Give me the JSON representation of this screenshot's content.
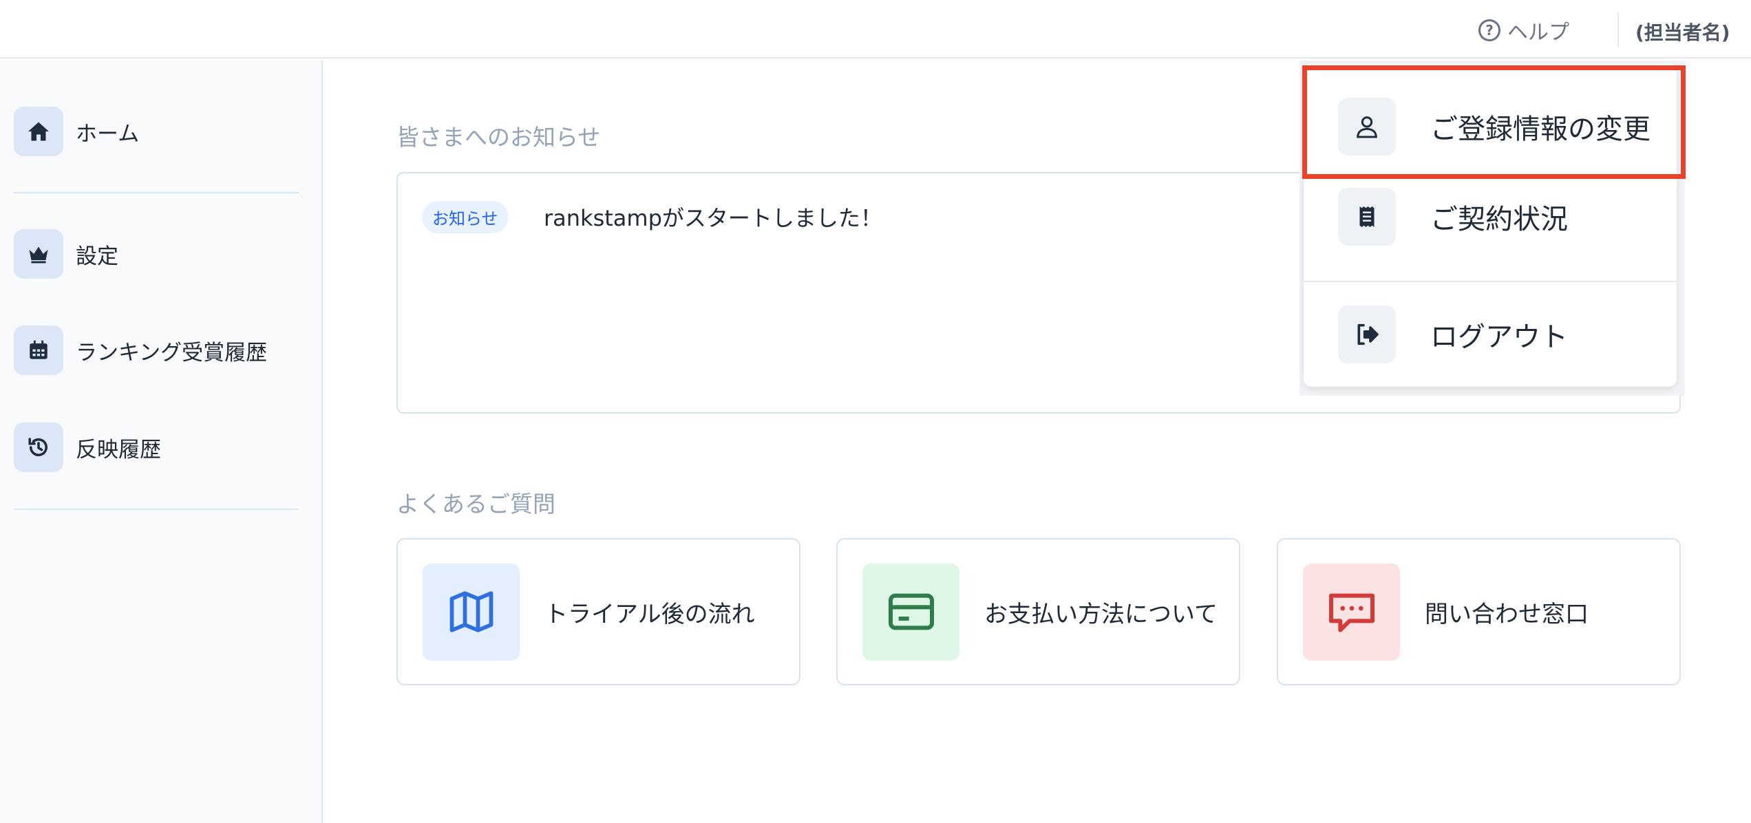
{
  "header": {
    "help_label": "ヘルプ",
    "help_icon": "question-circle-icon",
    "user_name": "(担当者名)"
  },
  "sidebar": {
    "items": [
      {
        "label": "ホーム",
        "icon": "home-icon"
      },
      {
        "label": "設定",
        "icon": "crown-icon"
      },
      {
        "label": "ランキング受賞履歴",
        "icon": "calendar-icon"
      },
      {
        "label": "反映履歴",
        "icon": "history-icon"
      }
    ]
  },
  "main": {
    "notice_title": "皆さまへのお知らせ",
    "notice": {
      "badge": "お知らせ",
      "text": "rankstampがスタートしました！"
    },
    "faq_title": "よくあるご質問",
    "faq": [
      {
        "label": "トライアル後の流れ",
        "icon": "map-icon",
        "bg": "#e3efff",
        "color": "#2f6fe0"
      },
      {
        "label": "お支払い方法について",
        "icon": "credit-card-icon",
        "bg": "#dff7e6",
        "color": "#2f7d4a"
      },
      {
        "label": "問い合わせ窓口",
        "icon": "chat-bubble-icon",
        "bg": "#fbe3e3",
        "color": "#d33a3a"
      }
    ]
  },
  "user_menu": {
    "items": [
      {
        "label": "ご登録情報の変更",
        "icon": "user-icon"
      },
      {
        "label": "ご契約状況",
        "icon": "receipt-icon"
      },
      {
        "label": "ログアウト",
        "icon": "logout-icon"
      }
    ],
    "highlight_color": "#e8432a"
  }
}
